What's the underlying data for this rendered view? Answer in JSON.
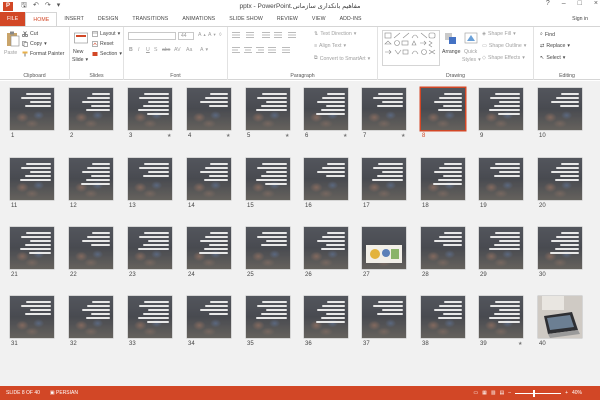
{
  "window": {
    "title": "مفاهیم بانکداری سازمانی.pptx - PowerPoint",
    "app_icon": "P",
    "signin": "Sign in",
    "help": "?",
    "minimize": "–",
    "maximize": "□",
    "close": "×",
    "qat": {
      "save": "🖫",
      "undo": "↶",
      "redo": "↷",
      "customize": "▾"
    }
  },
  "tabs": [
    "FILE",
    "HOME",
    "INSERT",
    "DESIGN",
    "TRANSITIONS",
    "ANIMATIONS",
    "SLIDE SHOW",
    "REVIEW",
    "VIEW",
    "ADD-INS"
  ],
  "ribbon": {
    "clipboard": {
      "label": "Clipboard",
      "paste": "Paste",
      "cut": "Cut",
      "copy": "Copy",
      "format_painter": "Format Painter"
    },
    "slides": {
      "label": "Slides",
      "new_slide": "New",
      "new_slide_2": "Slide",
      "layout": "Layout",
      "reset": "Reset",
      "section": "Section"
    },
    "font": {
      "label": "Font",
      "font_size": "44",
      "bold": "B",
      "italic": "I",
      "underline": "U",
      "shadow": "S",
      "strike": "abc",
      "spacing": "AV",
      "case": "Aa",
      "color": "A"
    },
    "paragraph": {
      "label": "Paragraph",
      "text_direction": "Text Direction",
      "align_text": "Align Text",
      "convert_smartart": "Convert to SmartArt"
    },
    "drawing": {
      "label": "Drawing",
      "arrange": "Arrange",
      "quick_styles": "Quick",
      "quick_styles_2": "Styles",
      "shape_fill": "Shape Fill",
      "shape_outline": "Shape Outline",
      "shape_effects": "Shape Effects"
    },
    "editing": {
      "label": "Editing",
      "find": "Find",
      "replace": "Replace",
      "select": "Select"
    }
  },
  "slides": {
    "total": 40,
    "selected": 8,
    "starred": [
      3,
      4,
      5,
      6,
      7,
      39
    ],
    "picture_slides": [
      27,
      40
    ]
  },
  "status": {
    "slide_info": "SLIDE 8 OF 40",
    "language": "PERSIAN",
    "zoom": "40%",
    "zoom_minus": "–",
    "zoom_plus": "+",
    "zoom_value": 0.4
  },
  "colors": {
    "accent": "#d24726"
  }
}
